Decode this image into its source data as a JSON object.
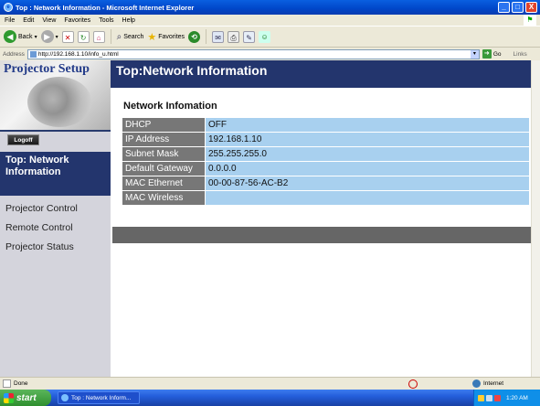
{
  "window": {
    "title": "Top : Network Information - Microsoft Internet Explorer",
    "min": "_",
    "max": "□",
    "close": "X"
  },
  "menu": [
    "File",
    "Edit",
    "View",
    "Favorites",
    "Tools",
    "Help"
  ],
  "toolbar": {
    "back_label": "Back",
    "search_label": "Search",
    "favorites_label": "Favorites"
  },
  "address": {
    "label": "Address",
    "url": "http://192.168.1.10/info_u.html",
    "go_label": "Go",
    "links_label": "Links"
  },
  "sidebar": {
    "brand": "Projector Setup",
    "logoff": "Logoff",
    "active": "Top: Network Information",
    "items": [
      "Projector Control",
      "Remote Control",
      "Projector Status"
    ]
  },
  "page": {
    "header": "Top:Network Information",
    "section_title": "Network Infomation",
    "rows": [
      {
        "label": "DHCP",
        "value": "OFF"
      },
      {
        "label": "IP Address",
        "value": "192.168.1.10"
      },
      {
        "label": "Subnet Mask",
        "value": "255.255.255.0"
      },
      {
        "label": "Default Gateway",
        "value": "0.0.0.0"
      },
      {
        "label": "MAC Ethernet",
        "value": "00-00-87-56-AC-B2"
      },
      {
        "label": "MAC Wireless",
        "value": ""
      }
    ]
  },
  "status": {
    "text": "Done",
    "zone": "Internet"
  },
  "taskbar": {
    "start": "start",
    "task": "Top : Network Inform...",
    "clock": "1:20 AM"
  },
  "colors": {
    "nav_dark": "#23356d",
    "value_cell": "#a8d0ef",
    "label_cell": "#777777"
  }
}
